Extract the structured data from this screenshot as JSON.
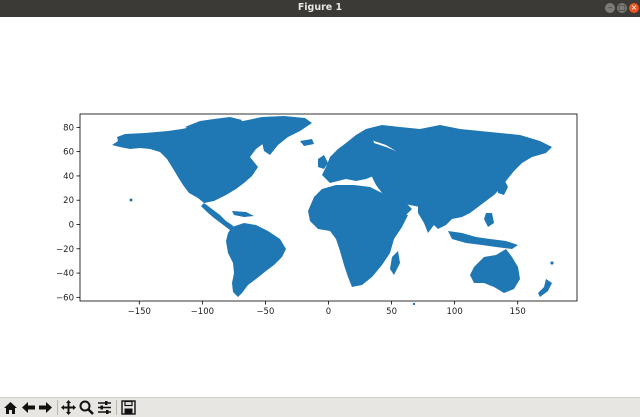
{
  "window": {
    "title": "Figure 1"
  },
  "title_buttons": {
    "minimize": "–",
    "maximize": "□",
    "close": "×"
  },
  "icons": {
    "home": "home-icon",
    "back": "back-arrow-icon",
    "forward": "forward-arrow-icon",
    "pan": "pan-move-icon",
    "zoom": "zoom-magnifier-icon",
    "configure": "subplots-config-icon",
    "save": "save-floppy-icon"
  },
  "chart_data": {
    "type": "map",
    "title": "",
    "xlabel": "",
    "ylabel": "",
    "xlim": [
      -197,
      197
    ],
    "ylim": [
      -63,
      91
    ],
    "xticks": [
      -150,
      -100,
      -50,
      0,
      50,
      100,
      150
    ],
    "yticks": [
      80,
      60,
      40,
      20,
      0,
      -20,
      -40,
      -60
    ],
    "xtick_labels": [
      "−150",
      "−100",
      "−50",
      "0",
      "50",
      "100",
      "150"
    ],
    "ytick_labels": [
      "80",
      "60",
      "40",
      "20",
      "0",
      "−20",
      "−40",
      "−60"
    ],
    "fill_color": "#1f77b4",
    "grid": false
  }
}
